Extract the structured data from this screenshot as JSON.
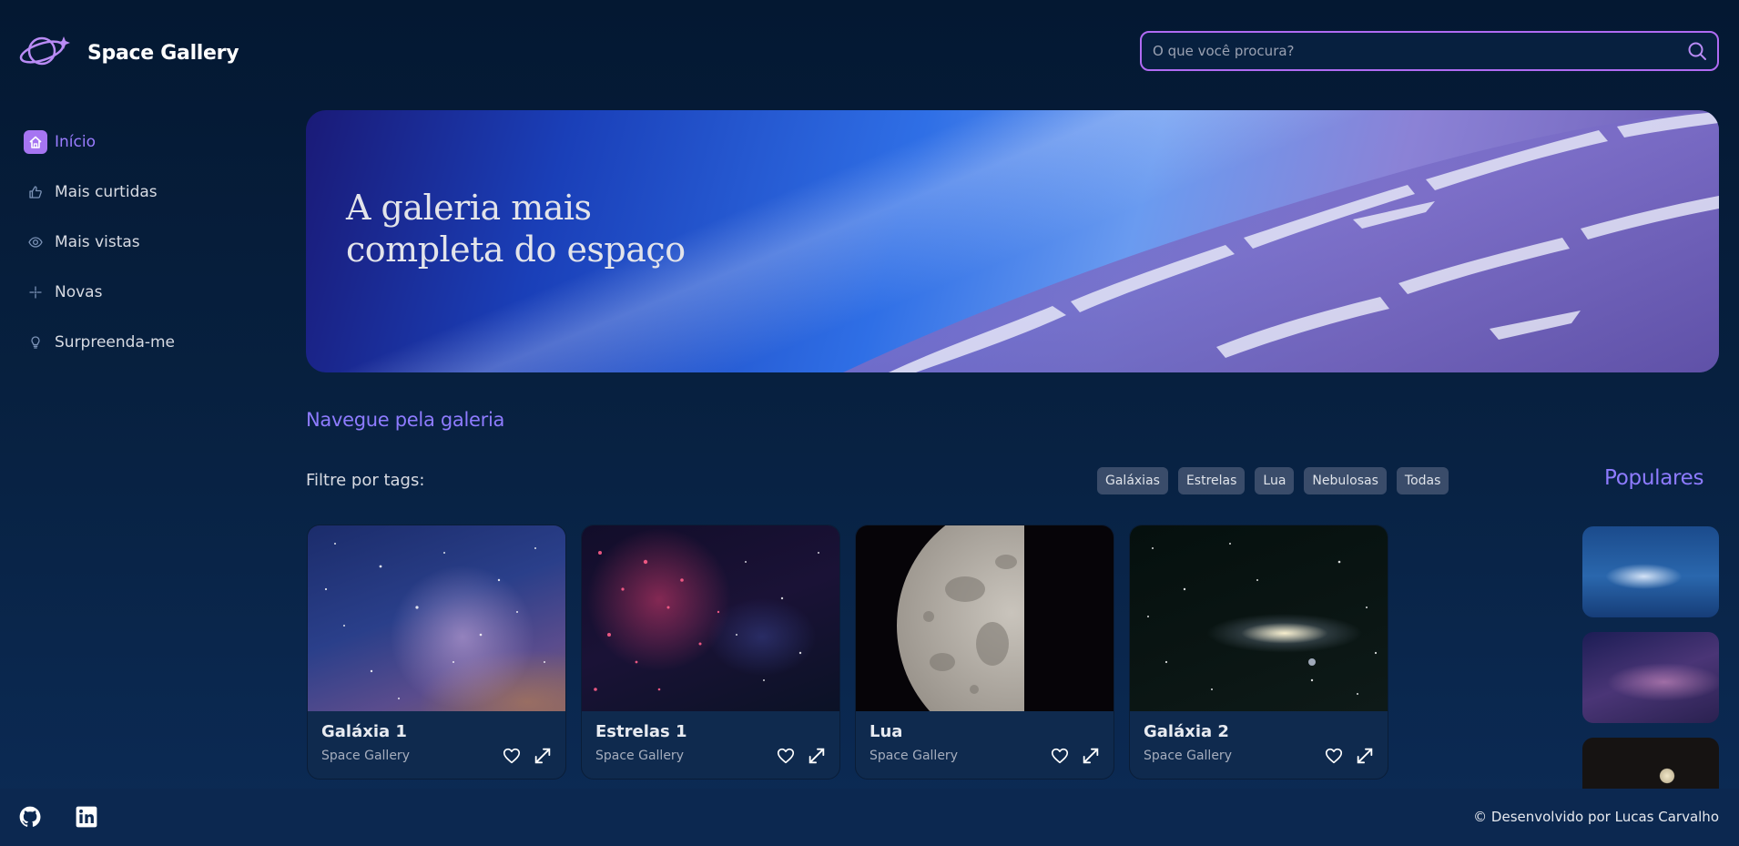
{
  "brand": {
    "name": "Space Gallery",
    "logo_icon": "planet-icon"
  },
  "search": {
    "placeholder": "O que você procura?",
    "value": "",
    "icon": "search-icon"
  },
  "sidebar": {
    "items": [
      {
        "label": "Início",
        "icon": "home-icon",
        "active": true
      },
      {
        "label": "Mais curtidas",
        "icon": "thumbs-up-icon",
        "active": false
      },
      {
        "label": "Mais vistas",
        "icon": "eye-icon",
        "active": false
      },
      {
        "label": "Novas",
        "icon": "sparkle-icon",
        "active": false
      },
      {
        "label": "Surpreenda-me",
        "icon": "lightbulb-icon",
        "active": false
      }
    ]
  },
  "banner": {
    "title": "A galeria mais completa do espaço"
  },
  "gallery": {
    "title": "Navegue pela galeria",
    "filter_label": "Filtre por tags:",
    "tags": [
      "Galáxias",
      "Estrelas",
      "Lua",
      "Nebulosas",
      "Todas"
    ],
    "cards": [
      {
        "title": "Galáxia 1",
        "subtitle": "Space Gallery"
      },
      {
        "title": "Estrelas 1",
        "subtitle": "Space Gallery"
      },
      {
        "title": "Lua",
        "subtitle": "Space Gallery"
      },
      {
        "title": "Galáxia 2",
        "subtitle": "Space Gallery"
      }
    ]
  },
  "popular": {
    "title": "Populares",
    "count_visible": 3
  },
  "footer": {
    "social": [
      "github-icon",
      "linkedin-icon"
    ],
    "copyright": "© Desenvolvido por Lucas Carvalho"
  },
  "colors": {
    "accent": "#8e7bff",
    "active_icon_bg": "#a675f2",
    "search_border": "#b06bf3",
    "background": "#041832",
    "footer_bg": "#0c2850",
    "tag_bg": "#3a4c6a"
  }
}
